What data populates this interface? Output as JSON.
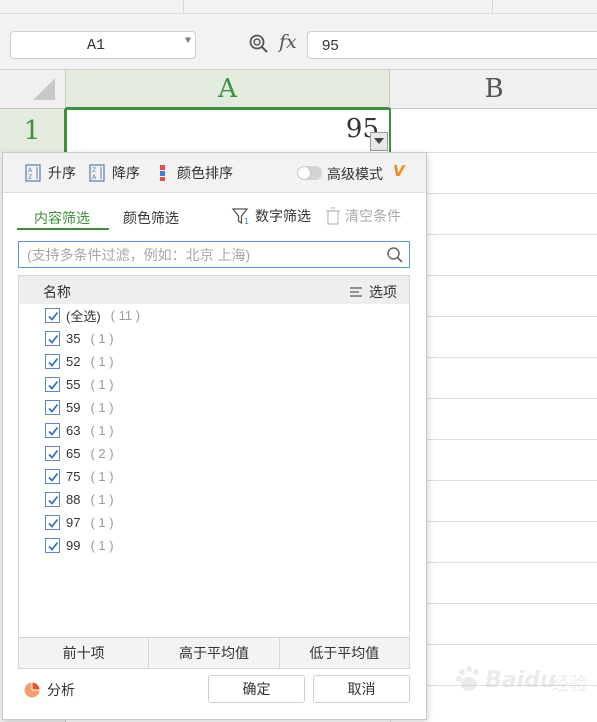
{
  "formula_bar": {
    "cell_ref": "A1",
    "fx_label": "fx",
    "formula_value": "95"
  },
  "grid": {
    "columns": [
      "A",
      "B"
    ],
    "rows": [
      "1"
    ],
    "cell_a1_value": "95"
  },
  "filter_panel": {
    "sort_ascending": "升序",
    "sort_descending": "降序",
    "sort_by_color": "颜色排序",
    "advanced_mode": "高级模式",
    "tabs": {
      "content_filter": "内容筛选",
      "color_filter": "颜色筛选"
    },
    "number_filter": "数字筛选",
    "clear_conditions": "清空条件",
    "search_placeholder": "(支持多条件过滤，例如：北京 上海)",
    "list_header": "名称",
    "options_label": "选项",
    "items": [
      {
        "label": "(全选)",
        "count": "( 11 )",
        "checked": true
      },
      {
        "label": "35",
        "count": "( 1 )",
        "checked": true
      },
      {
        "label": "52",
        "count": "( 1 )",
        "checked": true
      },
      {
        "label": "55",
        "count": "( 1 )",
        "checked": true
      },
      {
        "label": "59",
        "count": "( 1 )",
        "checked": true
      },
      {
        "label": "63",
        "count": "( 1 )",
        "checked": true
      },
      {
        "label": "65",
        "count": "( 2 )",
        "checked": true
      },
      {
        "label": "75",
        "count": "( 1 )",
        "checked": true
      },
      {
        "label": "88",
        "count": "( 1 )",
        "checked": true
      },
      {
        "label": "97",
        "count": "( 1 )",
        "checked": true
      },
      {
        "label": "99",
        "count": "( 1 )",
        "checked": true
      }
    ],
    "quick_buttons": [
      "前十项",
      "高于平均值",
      "低于平均值"
    ],
    "analysis": "分析",
    "confirm": "确定",
    "cancel": "取消"
  },
  "colors": {
    "accent_green": "#3f8f3f",
    "checkbox_blue": "#5b87c8",
    "vip_orange": "#f08a24"
  },
  "watermark": {
    "text": "Baidu",
    "sub": "经验"
  }
}
